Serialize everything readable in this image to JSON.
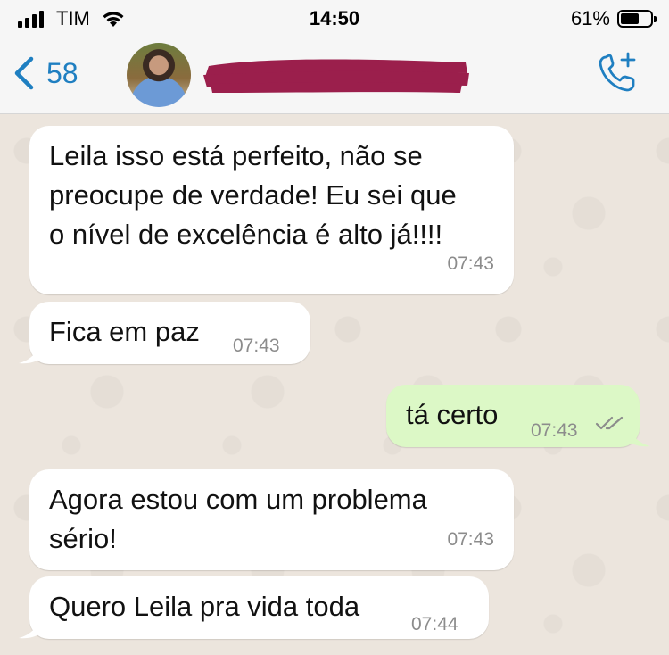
{
  "status_bar": {
    "carrier": "TIM",
    "time": "14:50",
    "battery_percent_text": "61%",
    "battery_level": 0.61
  },
  "header": {
    "back_count": "58",
    "contact_name_redacted": true,
    "icons": {
      "back": "chevron-left-icon",
      "call": "phone-add-icon"
    }
  },
  "messages": [
    {
      "direction": "incoming",
      "lines": [
        "Leila isso está perfeito, não se",
        "preocupe de verdade! Eu sei que",
        "o nível de excelência é alto já!!!!"
      ],
      "time": "07:43"
    },
    {
      "direction": "incoming",
      "lines": [
        "Fica em paz"
      ],
      "time": "07:43"
    },
    {
      "direction": "outgoing",
      "lines": [
        "tá certo"
      ],
      "time": "07:43",
      "status": "read"
    },
    {
      "direction": "incoming",
      "lines": [
        "Agora estou com um problema",
        "sério!"
      ],
      "time": "07:43"
    },
    {
      "direction": "incoming",
      "lines": [
        "Quero Leila pra vida toda"
      ],
      "time": "07:44"
    }
  ],
  "colors": {
    "accent": "#1f7fc1",
    "incoming_bubble": "#ffffff",
    "outgoing_bubble": "#dcf8c6",
    "read_ticks": "#8c8c8c",
    "redaction": "#9b1f4c"
  }
}
